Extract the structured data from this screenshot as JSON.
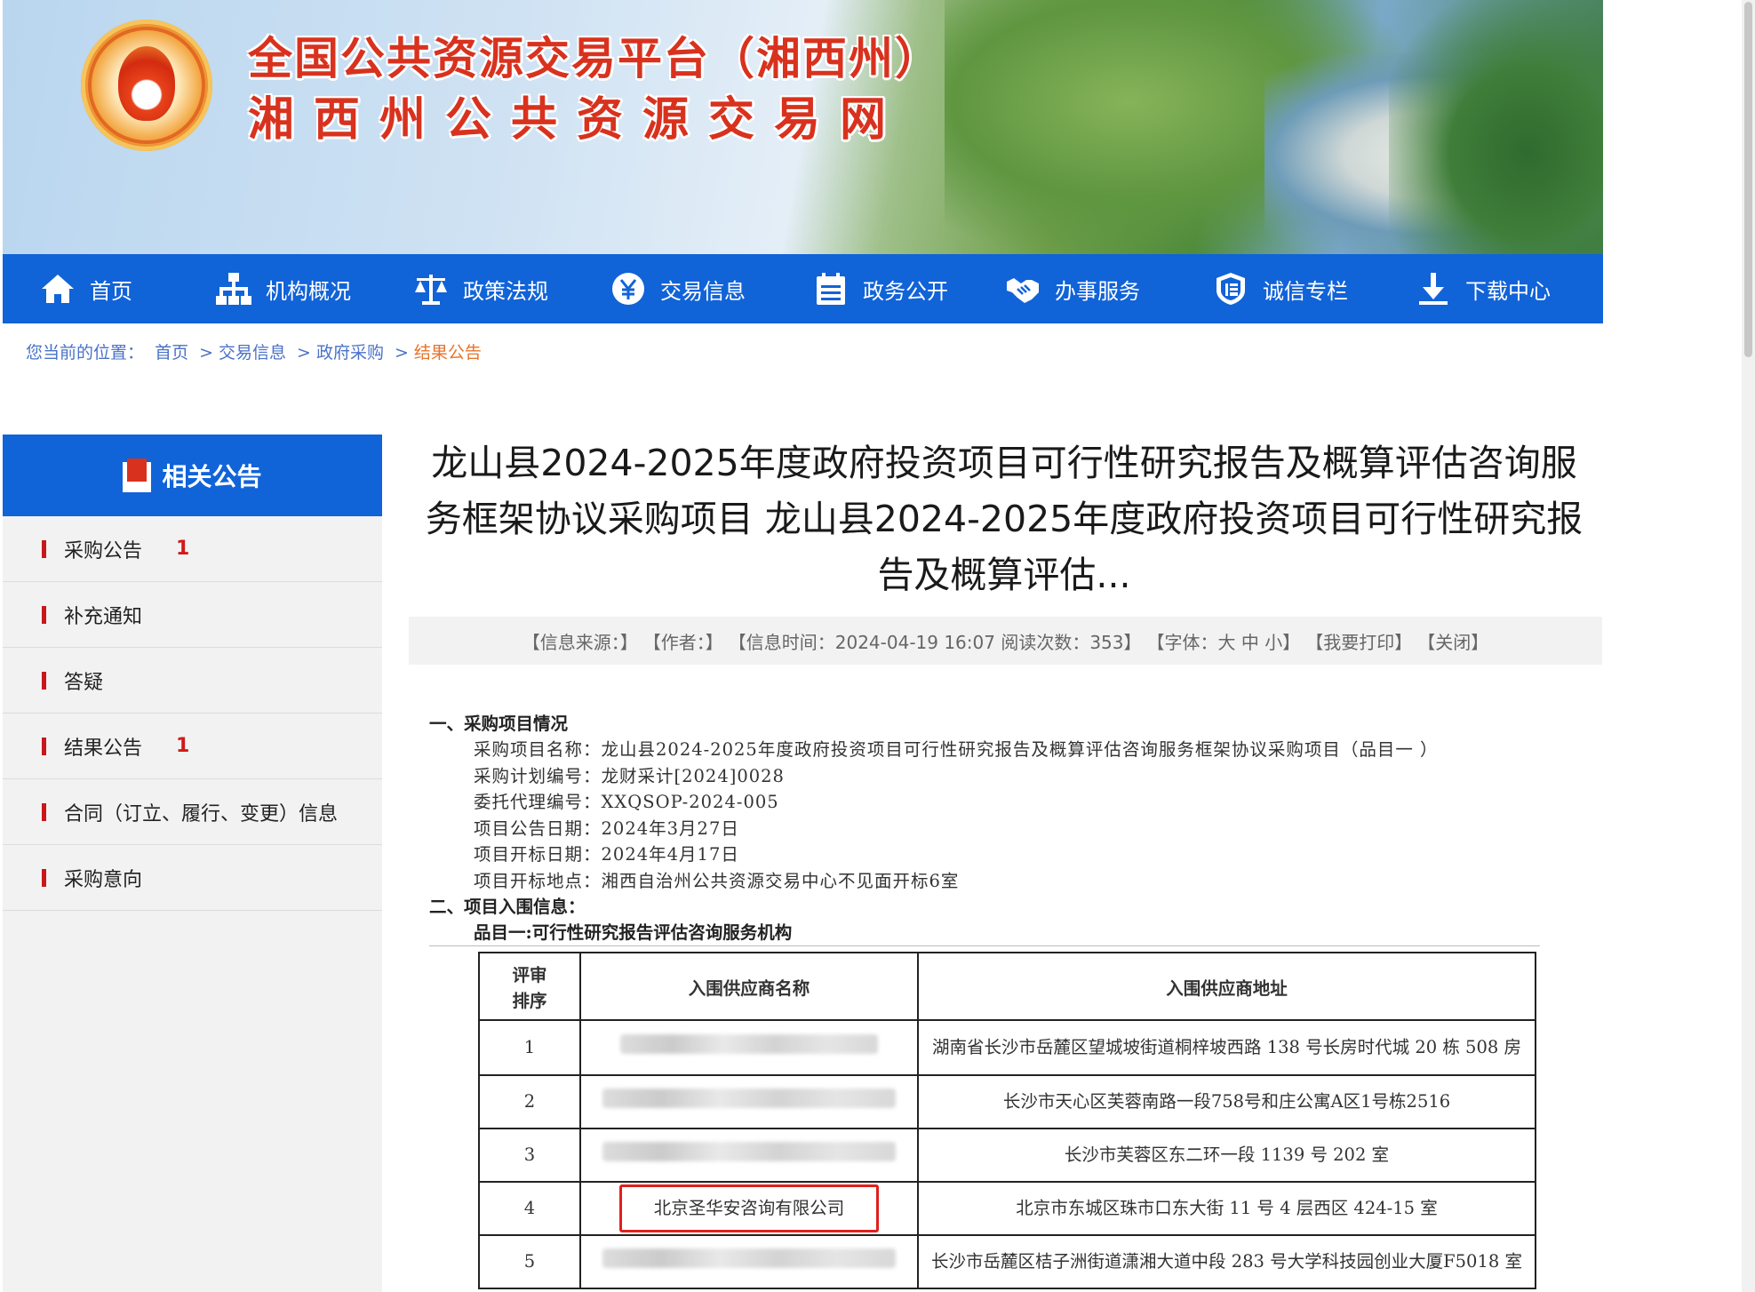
{
  "header": {
    "title_line1": "全国公共资源交易平台（湘西州）",
    "title_line2": "湘西州公共资源交易网",
    "logo_icon": "emblem-flame-icon"
  },
  "nav": [
    {
      "label": "首页",
      "icon": "home-icon"
    },
    {
      "label": "机构概况",
      "icon": "org-chart-icon"
    },
    {
      "label": "政策法规",
      "icon": "scales-icon"
    },
    {
      "label": "交易信息",
      "icon": "yuan-coin-icon"
    },
    {
      "label": "政务公开",
      "icon": "calendar-list-icon"
    },
    {
      "label": "办事服务",
      "icon": "handshake-icon"
    },
    {
      "label": "诚信专栏",
      "icon": "credit-shield-icon"
    },
    {
      "label": "下载中心",
      "icon": "download-icon"
    }
  ],
  "breadcrumb": {
    "prefix": "您当前的位置：",
    "items": [
      "首页",
      "交易信息",
      "政府采购",
      "结果公告"
    ],
    "separator": ">"
  },
  "sidebar": {
    "title": "相关公告",
    "items": [
      {
        "label": "采购公告",
        "badge": "1"
      },
      {
        "label": "补充通知",
        "badge": ""
      },
      {
        "label": "答疑",
        "badge": ""
      },
      {
        "label": "结果公告",
        "badge": "1"
      },
      {
        "label": "合同（订立、履行、变更）信息",
        "badge": ""
      },
      {
        "label": "采购意向",
        "badge": ""
      }
    ]
  },
  "article": {
    "title_line1": "龙山县2024-2025年度政府投资项目可行性研究报告及概算评估咨询服",
    "title_line2": "务框架协议采购项目 龙山县2024-2025年度政府投资项目可行性研究报",
    "title_line3": "告及概算评估...",
    "meta": {
      "source": "【信息来源：】",
      "author": "【作者：】",
      "time": "【信息时间：2024-04-19 16:07 阅读次数：353】",
      "font": "【字体：大 中 小】",
      "print": "【我要打印】",
      "close": "【关闭】"
    },
    "section1_heading": "一、采购项目情况",
    "section1_rows": [
      "采购项目名称：龙山县2024-2025年度政府投资项目可行性研究报告及概算评估咨询服务框架协议采购项目（品目一 ）",
      "采购计划编号：龙财采计[2024]0028",
      "委托代理编号：XXQSOP-2024-005",
      "项目公告日期：2024年3月27日",
      "项目开标日期：2024年4月17日",
      "项目开标地点：湘西自治州公共资源交易中心不见面开标6室"
    ],
    "section2_heading": "二、项目入围信息：",
    "subheading": "品目一:可行性研究报告评估咨询服务机构"
  },
  "table": {
    "headers": [
      "评审\n排序",
      "入围供应商名称",
      "入围供应商地址"
    ],
    "header_rank_l1": "评审",
    "header_rank_l2": "排序",
    "rows": [
      {
        "rank": "1",
        "name": "",
        "address": "湖南省长沙市岳麓区望城坡街道桐梓坡西路 138 号长房时代城 20 栋 508 房"
      },
      {
        "rank": "2",
        "name": "",
        "address": "长沙市天心区芙蓉南路一段758号和庄公寓A区1号栋2516"
      },
      {
        "rank": "3",
        "name": "",
        "address": "长沙市芙蓉区东二环一段 1139 号 202 室"
      },
      {
        "rank": "4",
        "name": "北京圣华安咨询有限公司",
        "address": "北京市东城区珠市口东大街 11 号 4 层西区 424-15 室"
      },
      {
        "rank": "5",
        "name": "",
        "address": "长沙市岳麓区桔子洲街道潇湘大道中段 283 号大学科技园创业大厦F5018 室"
      }
    ]
  },
  "colors": {
    "nav_blue": "#1163d8",
    "title_red": "#d8321e",
    "breadcrumb_blue": "#4a72c6",
    "breadcrumb_current": "#e8742b",
    "badge_red": "#d11a1a",
    "highlight_red": "#e0201c"
  }
}
